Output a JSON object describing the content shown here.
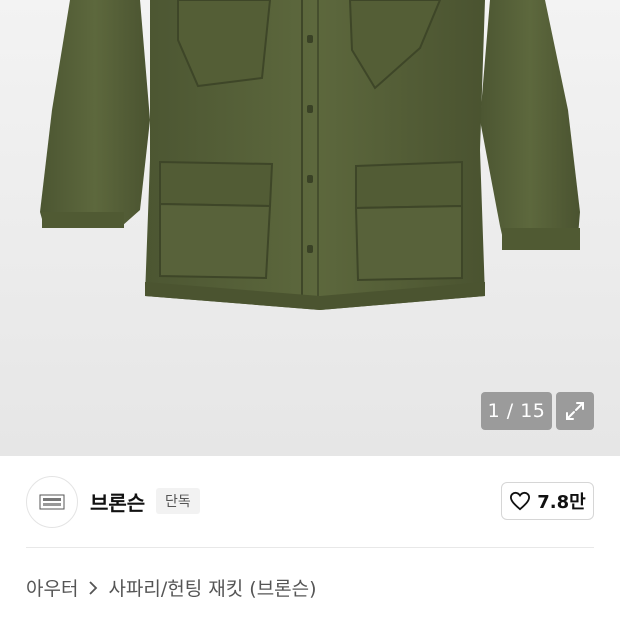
{
  "gallery": {
    "current": "1",
    "total": "15",
    "separator": " / ",
    "image_subject": "olive-green-safari-jacket"
  },
  "brand": {
    "name": "브론슨",
    "badge": "단독",
    "logo_icon": "bronson-logo-icon"
  },
  "like": {
    "icon": "heart-icon",
    "count": "7.8만"
  },
  "breadcrumb": {
    "items": [
      "아우터",
      "사파리/헌팅 재킷 (브론슨)"
    ],
    "separator_icon": "chevron-right-icon"
  },
  "colors": {
    "jacket": "#58633a",
    "background": "#ececec",
    "overlay": "#828282"
  }
}
